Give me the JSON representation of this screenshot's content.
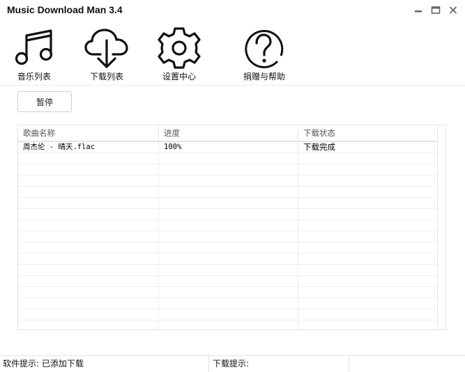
{
  "window": {
    "title": "Music Download Man 3.4",
    "controls": [
      {
        "name": "minimize",
        "icon": "minimize-icon"
      },
      {
        "name": "maximize",
        "icon": "maximize-icon"
      },
      {
        "name": "close",
        "icon": "close-icon"
      }
    ]
  },
  "nav": {
    "items": [
      {
        "label": "音乐列表",
        "icon": "music-note-icon"
      },
      {
        "label": "下载列表",
        "icon": "cloud-download-icon"
      },
      {
        "label": "设置中心",
        "icon": "gear-icon"
      },
      {
        "label": "捐赠与帮助",
        "icon": "help-circle-icon"
      }
    ]
  },
  "toolbar": {
    "pause_label": "暂停"
  },
  "table": {
    "columns": [
      "歌曲名称",
      "进度",
      "下载状态"
    ],
    "rows": [
      {
        "name": "周杰伦 - 晴天.flac",
        "progress": "100%",
        "status": "下载完成"
      }
    ]
  },
  "statusbar": {
    "software_hint": "软件提示: 已添加下载",
    "download_hint": "下载提示:",
    "extra": ""
  }
}
